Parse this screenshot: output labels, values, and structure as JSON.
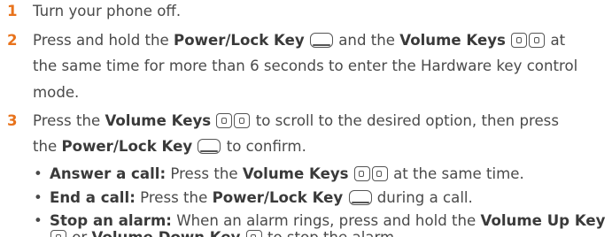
{
  "steps": [
    {
      "number": "1",
      "text": "Turn your phone off."
    },
    {
      "number": "2",
      "parts": {
        "a": "Press and hold the ",
        "b": "Power/Lock Key",
        "c": " and the ",
        "d": "Volume Keys",
        "e": " at",
        "line2": "the same time for more than 6 seconds to enter the Hardware key control",
        "line3": "mode."
      }
    },
    {
      "number": "3",
      "parts": {
        "a": "Press the ",
        "b": "Volume Keys",
        "c": " to scroll to the desired option, then press",
        "d": "the ",
        "e": "Power/Lock Key",
        "f": " to confirm."
      }
    }
  ],
  "bullets": [
    {
      "marker": "•",
      "label": "Answer a call:",
      "a": " Press the ",
      "b": "Volume Keys",
      "c": " at the same time."
    },
    {
      "marker": "•",
      "label": "End a call:",
      "a": " Press the ",
      "b": "Power/Lock Key",
      "c": " during a call."
    },
    {
      "marker": "•",
      "label": "Stop an alarm:",
      "a": " When an alarm rings, press and hold the ",
      "b": "Volume Up Key",
      "c": " or ",
      "d": "Volume Down Key",
      "e": " to stop the alarm."
    }
  ],
  "icons": {
    "power_key": "power-lock-key-icon",
    "volume_key": "volume-key-icon"
  },
  "colors": {
    "step_number": "#e8731c",
    "text": "#4a4a4a"
  }
}
